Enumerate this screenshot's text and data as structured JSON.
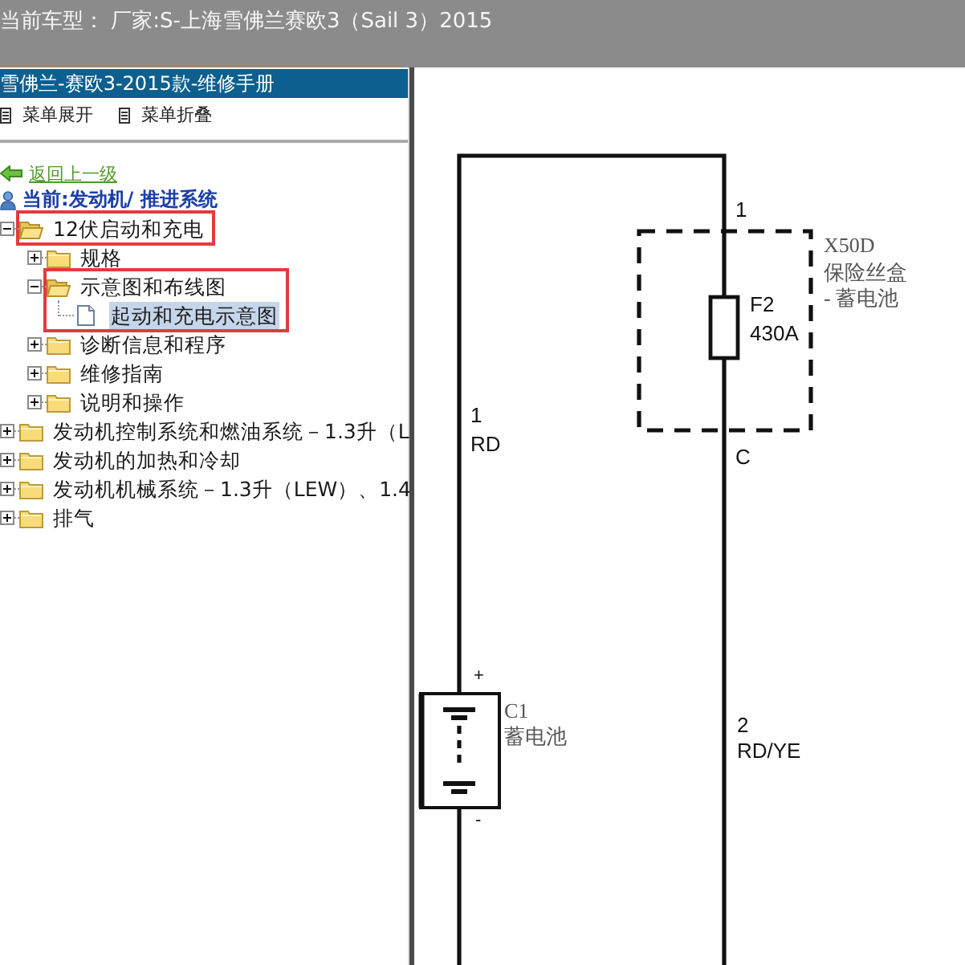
{
  "top_bar": {
    "vehicle": "当前车型： 厂家:S-上海雪佛兰赛欧3（Sail 3）2015"
  },
  "manual_panel": {
    "title": "雪佛兰-赛欧3-2015款-维修手册",
    "toolbar": [
      {
        "label": "菜单展开"
      },
      {
        "label": "菜单折叠"
      }
    ],
    "back_link": "返回上一级",
    "current_path": "当前:发动机/ 推进系统",
    "tree": [
      {
        "kind": "folder",
        "label": "12伏启动和充电",
        "expanded": true,
        "selected": false,
        "highlighted": true,
        "highlight_includes_children": false,
        "children": [
          {
            "kind": "folder",
            "label": "规格",
            "expanded": false,
            "selected": false
          },
          {
            "kind": "folder",
            "label": "示意图和布线图",
            "expanded": true,
            "selected": false,
            "highlighted": true,
            "highlight_includes_children": true,
            "children": [
              {
                "kind": "document",
                "label": "起动和充电示意图",
                "selected": true
              }
            ]
          },
          {
            "kind": "folder",
            "label": "诊断信息和程序",
            "expanded": false,
            "selected": false
          },
          {
            "kind": "folder",
            "label": "维修指南",
            "expanded": false,
            "selected": false
          },
          {
            "kind": "folder",
            "label": "说明和操作",
            "expanded": false,
            "selected": false
          }
        ]
      },
      {
        "kind": "folder",
        "label": "发动机控制系统和燃油系统－1.3升（L",
        "expanded": false,
        "selected": false
      },
      {
        "kind": "folder",
        "label": "发动机的加热和冷却",
        "expanded": false,
        "selected": false
      },
      {
        "kind": "folder",
        "label": "发动机机械系统－1.3升（LEW）、1.4",
        "expanded": false,
        "selected": false
      },
      {
        "kind": "folder",
        "label": "排气",
        "expanded": false,
        "selected": false
      }
    ]
  },
  "diagram": {
    "fuse_box": {
      "ref": "X50D",
      "name": "保险丝盒",
      "note": "- 蓄电池",
      "pin_in": "1",
      "pin_out": "C"
    },
    "fuse": {
      "ref": "F2",
      "rating": "430A"
    },
    "battery": {
      "ref": "C1",
      "name": "蓄电池",
      "positive": "+",
      "negative": "-"
    },
    "left_wire": {
      "circuit": "1",
      "code": "RD"
    },
    "right_wire": {
      "circuit": "2",
      "code": "RD/YE"
    }
  }
}
